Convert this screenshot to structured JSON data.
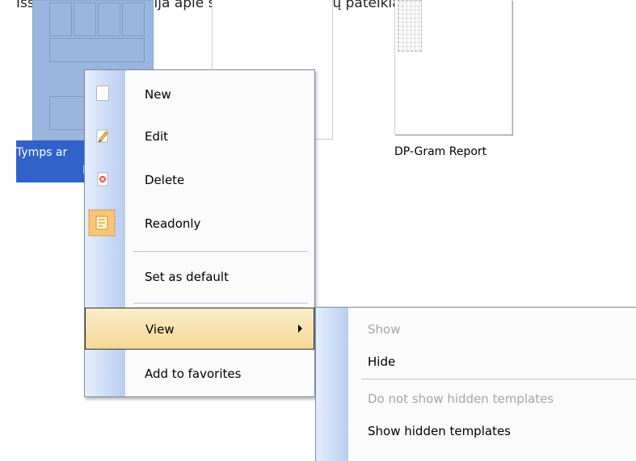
{
  "top_text": "Išsamesnė informacija apie spausdinimo vedlių pateikiama „Zyrd",
  "thumbnails": {
    "selected_label_line1": "Tymps ar",
    "selected_label_line2": "Re",
    "middle_label_fragment": ":",
    "third_label": "DP-Gram Report"
  },
  "context_menu": {
    "items": [
      {
        "label": "New",
        "icon": "new-document-icon"
      },
      {
        "label": "Edit",
        "icon": "edit-pencil-icon"
      },
      {
        "label": "Delete",
        "icon": "delete-icon"
      },
      {
        "label": "Readonly",
        "icon": "readonly-lock-icon"
      },
      {
        "label": "Set as default"
      },
      {
        "label": "View",
        "has_submenu": true,
        "highlighted": true
      },
      {
        "label": "Add to favorites"
      }
    ]
  },
  "view_submenu": {
    "items": [
      {
        "label": "Show",
        "disabled": true
      },
      {
        "label": "Hide",
        "disabled": false
      },
      {
        "label": "Do not show hidden templates",
        "disabled": true
      },
      {
        "label": "Show hidden templates",
        "disabled": false
      }
    ]
  },
  "colors": {
    "selection": "#3162c9",
    "menu_highlight": "#f6d898",
    "thumbnail_selected": "#9bb6de"
  }
}
